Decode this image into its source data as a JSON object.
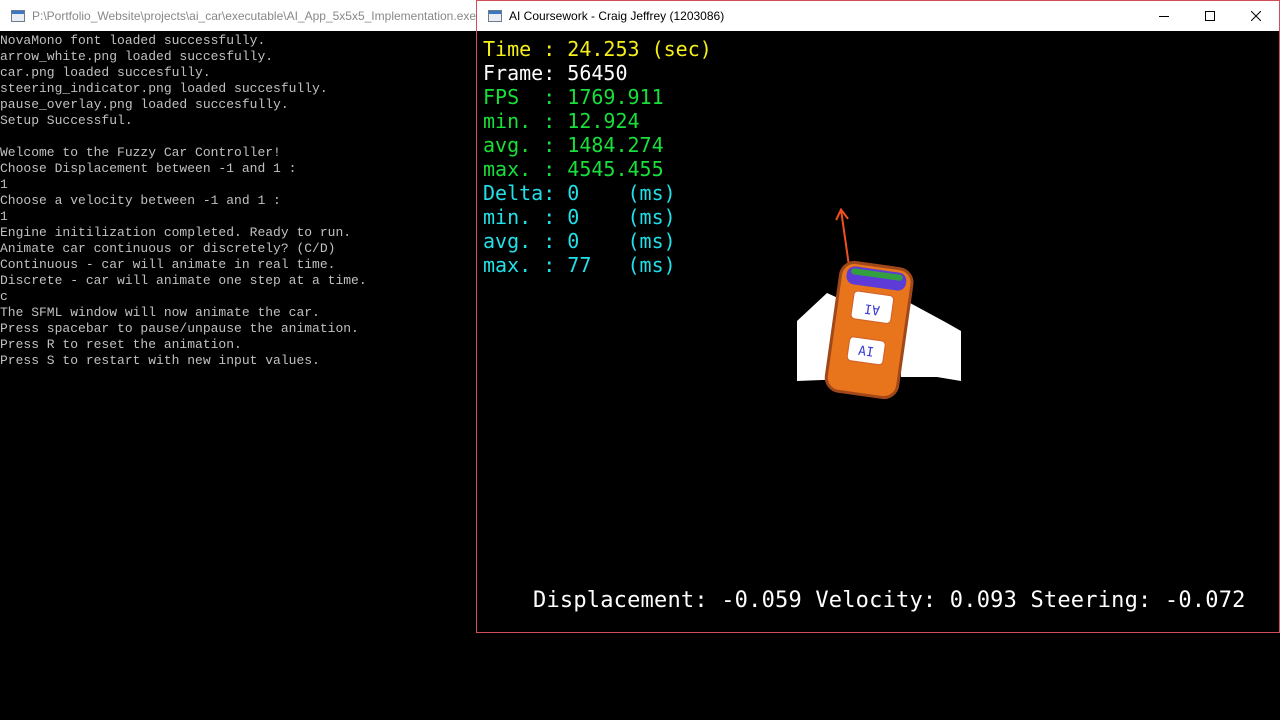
{
  "console": {
    "title": "P:\\Portfolio_Website\\projects\\ai_car\\executable\\AI_App_5x5x5_Implementation.exe",
    "lines": [
      "NovaMono font loaded successfully.",
      "arrow_white.png loaded succesfully.",
      "car.png loaded succesfully.",
      "steering_indicator.png loaded succesfully.",
      "pause_overlay.png loaded succesfully.",
      "Setup Successful.",
      "",
      "Welcome to the Fuzzy Car Controller!",
      "Choose Displacement between -1 and 1 :",
      "1",
      "Choose a velocity between -1 and 1 :",
      "1",
      "Engine initilization completed. Ready to run.",
      "Animate car continuous or discretely? (C/D)",
      "Continuous - car will animate in real time.",
      "Discrete - car will animate one step at a time.",
      "c",
      "The SFML window will now animate the car.",
      "Press spacebar to pause/unpause the animation.",
      "Press R to reset the animation.",
      "Press S to restart with new input values."
    ]
  },
  "sfml_window": {
    "title": "AI Coursework - Craig Jeffrey (1203086)",
    "controls": {
      "minimize_icon": "minimize-icon",
      "maximize_icon": "maximize-icon",
      "close_icon": "close-icon"
    },
    "stats": [
      {
        "text": "Time : 24.253 (sec)",
        "color": "yellow"
      },
      {
        "text": "Frame: 56450",
        "color": "white"
      },
      {
        "text": "FPS  : 1769.911",
        "color": "green"
      },
      {
        "text": "min. : 12.924",
        "color": "green"
      },
      {
        "text": "avg. : 1484.274",
        "color": "green"
      },
      {
        "text": "max. : 4545.455",
        "color": "green"
      },
      {
        "text": "Delta: 0    (ms)",
        "color": "cyan"
      },
      {
        "text": "min. : 0    (ms)",
        "color": "cyan"
      },
      {
        "text": "avg. : 0    (ms)",
        "color": "cyan"
      },
      {
        "text": "max. : 77   (ms)",
        "color": "cyan"
      }
    ],
    "readout": "Displacement: -0.059 Velocity: 0.093 Steering: -0.072",
    "car": {
      "roof_label": "AI",
      "hood_label": "AI",
      "body_color": "#e8741c",
      "arrow_color": "#f0501e"
    }
  },
  "colors": {
    "time": "#f5f019",
    "frame": "#ffffff",
    "fps": "#17e03a",
    "delta": "#22e0e8",
    "window_border": "#d24d57"
  }
}
